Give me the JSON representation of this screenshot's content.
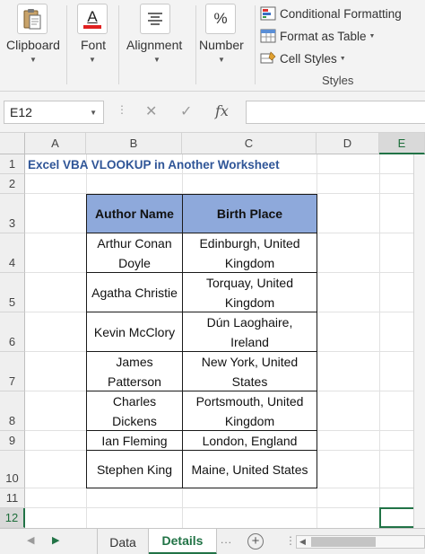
{
  "ribbon": {
    "groups": [
      {
        "label": "Clipboard",
        "icon": "clipboard-icon"
      },
      {
        "label": "Font",
        "icon": "font-color-icon",
        "glyph": "A"
      },
      {
        "label": "Alignment",
        "icon": "align-lines-icon"
      },
      {
        "label": "Number",
        "icon": "percent-icon",
        "glyph": "%"
      }
    ],
    "styles": {
      "conditional_formatting": "Conditional Formatting",
      "format_as_table": "Format as Table",
      "cell_styles": "Cell Styles",
      "group_label": "Styles"
    },
    "colors": {
      "table_header_fill": "#8ea9db",
      "title_text": "#2f5597",
      "accent": "#217346"
    }
  },
  "formula_bar": {
    "name_box": "E12",
    "cancel_glyph": "✕",
    "enter_glyph": "✓",
    "function_glyph": "fx",
    "formula": ""
  },
  "columns": [
    "A",
    "B",
    "C",
    "D",
    "E"
  ],
  "rows": [
    "1",
    "2",
    "3",
    "4",
    "5",
    "6",
    "7",
    "8",
    "9",
    "10",
    "11",
    "12"
  ],
  "selected_cell": "E12",
  "sheet": {
    "title": "Excel VBA VLOOKUP in Another Worksheet",
    "table": {
      "headers": [
        "Author Name",
        "Birth Place"
      ],
      "rows": [
        [
          "Arthur Conan Doyle",
          "Edinburgh, United Kingdom"
        ],
        [
          "Agatha Christie",
          "Torquay, United Kingdom"
        ],
        [
          "Kevin McClory",
          "Dún Laoghaire, Ireland"
        ],
        [
          "James Patterson",
          "New York, United States"
        ],
        [
          "Charles Dickens",
          "Portsmouth, United Kingdom"
        ],
        [
          "Ian Fleming",
          "London, England"
        ],
        [
          "Stephen King",
          "Maine, United States"
        ]
      ]
    }
  },
  "tabs": {
    "sheets": [
      "Data",
      "Details"
    ],
    "active": "Details",
    "more_glyph": "...",
    "add_glyph": "+"
  }
}
